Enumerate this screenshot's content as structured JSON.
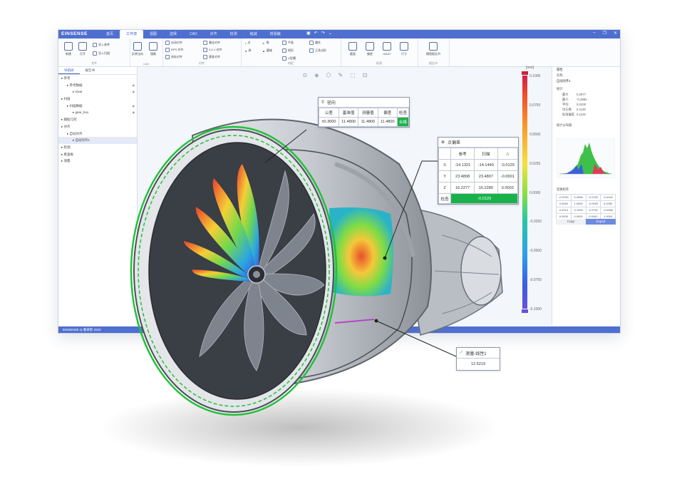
{
  "app": {
    "logo": "EINSENSE",
    "tabs": [
      "首页",
      "工作流",
      "视图",
      "选择",
      "CAD",
      "对齐",
      "检测",
      "缩减",
      "增强编"
    ],
    "active_tab": 1,
    "status": "EINSENSE Q 看采智 2023"
  },
  "ribbon": {
    "groups": [
      {
        "label": "文件",
        "items": [
          "新建",
          "打开",
          "导入参考",
          "导入扫描"
        ]
      },
      {
        "label": "CAD",
        "items": [
          "反转法向",
          "镜像"
        ]
      },
      {
        "label": "对齐",
        "items": [
          "自动对齐",
          "RPS 对齐",
          "3-2-1 对齐",
          "最佳对齐",
          "基准对齐",
          "坐标对齐"
        ]
      },
      {
        "label": "特征",
        "items": [
          "点",
          "球",
          "角",
          "圆锥",
          "平面",
          "矩形",
          "U型槽",
          "圆柱",
          "正多边形"
        ]
      },
      {
        "label": "检测",
        "items": [
          "截面",
          "偏差",
          "GD&T",
          "尺寸"
        ]
      },
      {
        "label": "报告书",
        "items": [
          "模版报告书"
        ]
      }
    ]
  },
  "left_panel": {
    "tabs": [
      "导航树",
      "报告书"
    ],
    "tree": [
      {
        "label": "参考",
        "depth": 0,
        "eye": false
      },
      {
        "label": "参考数据",
        "depth": 1,
        "eye": true
      },
      {
        "label": "Gear",
        "depth": 2,
        "eye": true
      },
      {
        "label": "扫描",
        "depth": 0,
        "eye": false
      },
      {
        "label": "扫描数据",
        "depth": 1,
        "eye": true
      },
      {
        "label": "gear_box",
        "depth": 2,
        "eye": true
      },
      {
        "label": "辅助几何",
        "depth": 0,
        "eye": false
      },
      {
        "label": "对齐",
        "depth": 0,
        "eye": false
      },
      {
        "label": "自动对齐",
        "depth": 1,
        "eye": false
      },
      {
        "label": "自动对齐1",
        "depth": 2,
        "eye": false,
        "selected": true
      },
      {
        "label": "检测",
        "depth": 0,
        "eye": false
      },
      {
        "label": "看查板",
        "depth": 0,
        "eye": false
      },
      {
        "label": "测量",
        "depth": 0,
        "eye": false
      }
    ]
  },
  "right_panel": {
    "title": "属性",
    "name_label": "名称",
    "name_value": "自动对齐1",
    "stats_title": "统计",
    "stats": [
      {
        "k": "最大",
        "v": "0.2977"
      },
      {
        "k": "最小",
        "v": "-0.2982"
      },
      {
        "k": "平均",
        "v": "0.0100"
      },
      {
        "k": "均方根",
        "v": "0.1129"
      },
      {
        "k": "标准偏差",
        "v": "0.1125"
      }
    ],
    "hist_title": "统计分布图",
    "matrix_title": "变换矩阵",
    "matrix": [
      [
        "-0.9750",
        "0.0056",
        "-0.2220",
        "-0.0342"
      ],
      [
        "0.0060",
        "1.0000",
        "-0.0009",
        "0.0283"
      ],
      [
        "0.2219",
        "-0.0022",
        "-0.9751",
        "-0.0366"
      ],
      [
        "0.0000",
        "0.0000",
        "0.0000",
        "1.0000"
      ]
    ],
    "copy": "Copy",
    "export": "Export"
  },
  "colorbar": {
    "unit": "[mm]",
    "ticks": [
      "0.1000",
      "0.0750",
      "0.0500",
      "0.0250",
      "0.0000",
      "-0.0250",
      "-0.0500",
      "-0.0750",
      "-0.1000"
    ]
  },
  "callouts": {
    "radial": {
      "title": "径向",
      "headers": [
        "公差",
        "基准值",
        "测量值",
        "偏差",
        "检查"
      ],
      "values": [
        "±0.3000",
        "11.4800",
        "11.4800",
        "11.4800",
        "合格"
      ]
    },
    "point": {
      "title": "点偏差",
      "headers": [
        "",
        "参考",
        "扫描",
        "△"
      ],
      "rows": [
        [
          "X",
          "-14.1321",
          "-14.1449",
          "-0.0129"
        ],
        [
          "Y",
          "23.4808",
          "23.4807",
          "-0.0001"
        ],
        [
          "Z",
          "16.2277",
          "16.2280",
          "0.0003"
        ]
      ],
      "check_label": "检查",
      "check_value": "-0.0129"
    },
    "linearity": {
      "title": "测量-线性1",
      "value": "12.5219"
    }
  },
  "colors": {
    "accent": "#4f6fd0",
    "pass": "#19b24a",
    "ring": "#22c23a"
  }
}
